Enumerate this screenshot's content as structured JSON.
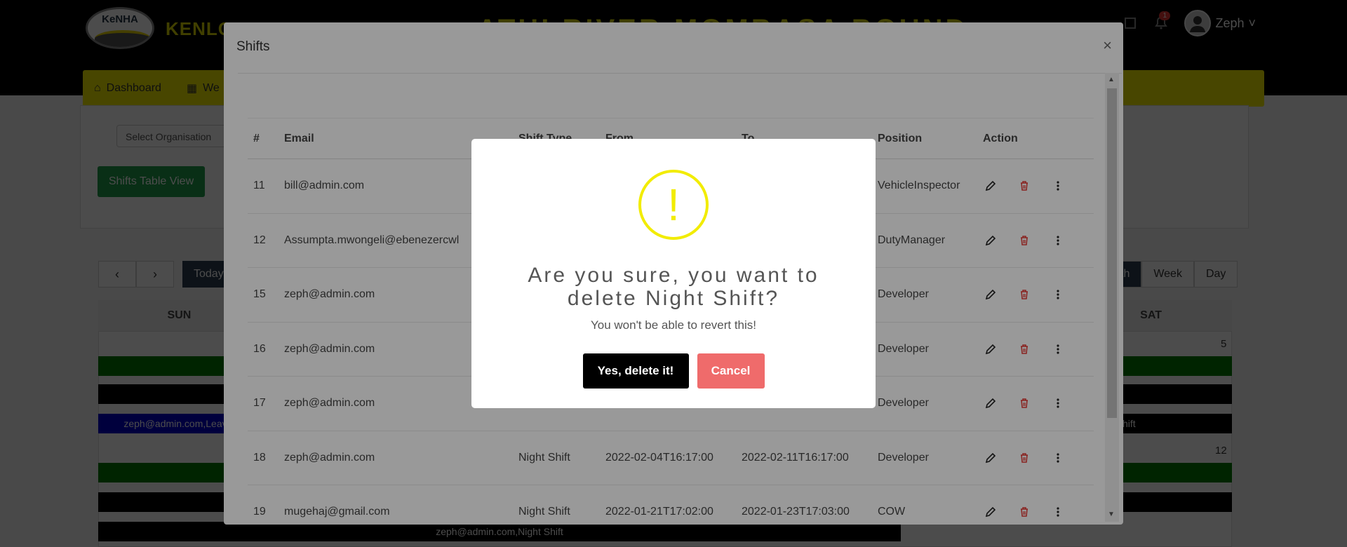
{
  "header": {
    "logo_text": "KeNHA",
    "brand": "KENLO",
    "page_heading": "ATHI RIVER-MOMBASA BOUND",
    "notification_count": "1",
    "user_name": "Zeph"
  },
  "nav": {
    "items": [
      {
        "label": "Dashboard"
      },
      {
        "label": "We"
      }
    ]
  },
  "filters": {
    "organisation_placeholder": "Select Organisation",
    "shifts_table_button": "Shifts Table View"
  },
  "calendar": {
    "prev": "‹",
    "next": "›",
    "today": "Today",
    "views": [
      "th",
      "Week",
      "Day"
    ],
    "days": [
      "SUN",
      "",
      "",
      "",
      "",
      "",
      "SAT"
    ],
    "day_numbers": [
      "5",
      "12"
    ],
    "events": [
      "zeph@admin.com,Leav",
      "hift",
      "zeph@admin.com,Night Shift"
    ]
  },
  "modal": {
    "title": "Shifts",
    "close": "×",
    "columns": [
      "#",
      "Email",
      "Shift Type",
      "From",
      "To",
      "Position",
      "Action"
    ],
    "rows": [
      {
        "id": "11",
        "email": "bill@admin.com",
        "type": "",
        "from": "",
        "to": "",
        "position": "VehicleInspector"
      },
      {
        "id": "12",
        "email": "Assumpta.mwongeli@ebenezercwl",
        "type": "",
        "from": "",
        "to": "",
        "position": "DutyManager"
      },
      {
        "id": "15",
        "email": "zeph@admin.com",
        "type": "",
        "from": "",
        "to": "",
        "position": "Developer"
      },
      {
        "id": "16",
        "email": "zeph@admin.com",
        "type": "",
        "from": "",
        "to": "",
        "position": "Developer"
      },
      {
        "id": "17",
        "email": "zeph@admin.com",
        "type": "",
        "from": "",
        "to": "",
        "position": "Developer"
      },
      {
        "id": "18",
        "email": "zeph@admin.com",
        "type": "Night Shift",
        "from": "2022-02-04T16:17:00",
        "to": "2022-02-11T16:17:00",
        "position": "Developer"
      },
      {
        "id": "19",
        "email": "mugehaj@gmail.com",
        "type": "Night Shift",
        "from": "2022-01-21T17:02:00",
        "to": "2022-01-23T17:03:00",
        "position": "COW"
      }
    ]
  },
  "alert": {
    "icon": "!",
    "title": "Are you sure, you want to delete Night Shift?",
    "text": "You won't be able to revert this!",
    "confirm": "Yes, delete it!",
    "cancel": "Cancel"
  },
  "colors": {
    "brand_yellow": "#f2ec00",
    "success_green": "#1f9e4a",
    "cancel_red": "#ef6b6b",
    "event_green": "#007a00",
    "event_blue": "#0000cc"
  }
}
